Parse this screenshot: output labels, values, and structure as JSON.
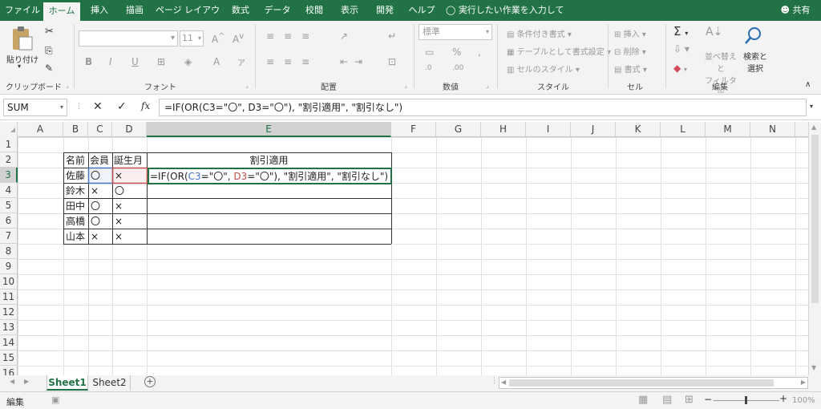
{
  "tabs": [
    "ファイル",
    "ホーム",
    "挿入",
    "描画",
    "ページ レイアウト",
    "数式",
    "データ",
    "校閲",
    "表示",
    "開発",
    "ヘルプ"
  ],
  "tell_me": "実行したい作業を入力してください",
  "share": "共有",
  "ribbon": {
    "paste": "貼り付け",
    "font_size": "11",
    "number_format": "標準",
    "cond_format": "条件付き書式",
    "table_format": "テーブルとして書式設定",
    "cell_style": "セルのスタイル",
    "insert": "挿入",
    "delete": "削除",
    "format": "書式",
    "sort_filter_1": "並べ替えと",
    "sort_filter_2": "フィルター",
    "find_1": "検索と",
    "find_2": "選択",
    "groups": {
      "clipboard": "クリップボード",
      "font": "フォント",
      "alignment": "配置",
      "number": "数値",
      "style": "スタイル",
      "cells": "セル",
      "editing": "編集"
    }
  },
  "name_box": "SUM",
  "formula": "=IF(OR(C3=\"〇\", D3=\"〇\"), \"割引適用\", \"割引なし\")",
  "columns": [
    "A",
    "B",
    "C",
    "D",
    "E",
    "F",
    "G",
    "H",
    "I",
    "J",
    "K",
    "L",
    "M",
    "N"
  ],
  "rows": [
    "1",
    "2",
    "3",
    "4",
    "5",
    "6",
    "7",
    "8",
    "9",
    "10",
    "11",
    "12",
    "13",
    "14",
    "15",
    "16"
  ],
  "table": {
    "headers": [
      "名前",
      "会員",
      "誕生月",
      "割引適用"
    ],
    "rows": [
      [
        "佐藤",
        "〇",
        "×"
      ],
      [
        "鈴木",
        "×",
        "〇"
      ],
      [
        "田中",
        "〇",
        "×"
      ],
      [
        "高橋",
        "〇",
        "×"
      ],
      [
        "山本",
        "×",
        "×"
      ]
    ],
    "edit": {
      "p1": "=IF(OR(",
      "c3": "C3",
      "p2": "=\"〇\", ",
      "d3": "D3",
      "p3": "=\"〇\"), \"割引適用\", \"割引なし\")"
    }
  },
  "sheets": [
    "Sheet1",
    "Sheet2"
  ],
  "status": "編集",
  "zoom": "100%",
  "colors": {
    "excel_green": "#217346",
    "ref_blue": "#4472c4",
    "ref_red": "#c0504d"
  }
}
